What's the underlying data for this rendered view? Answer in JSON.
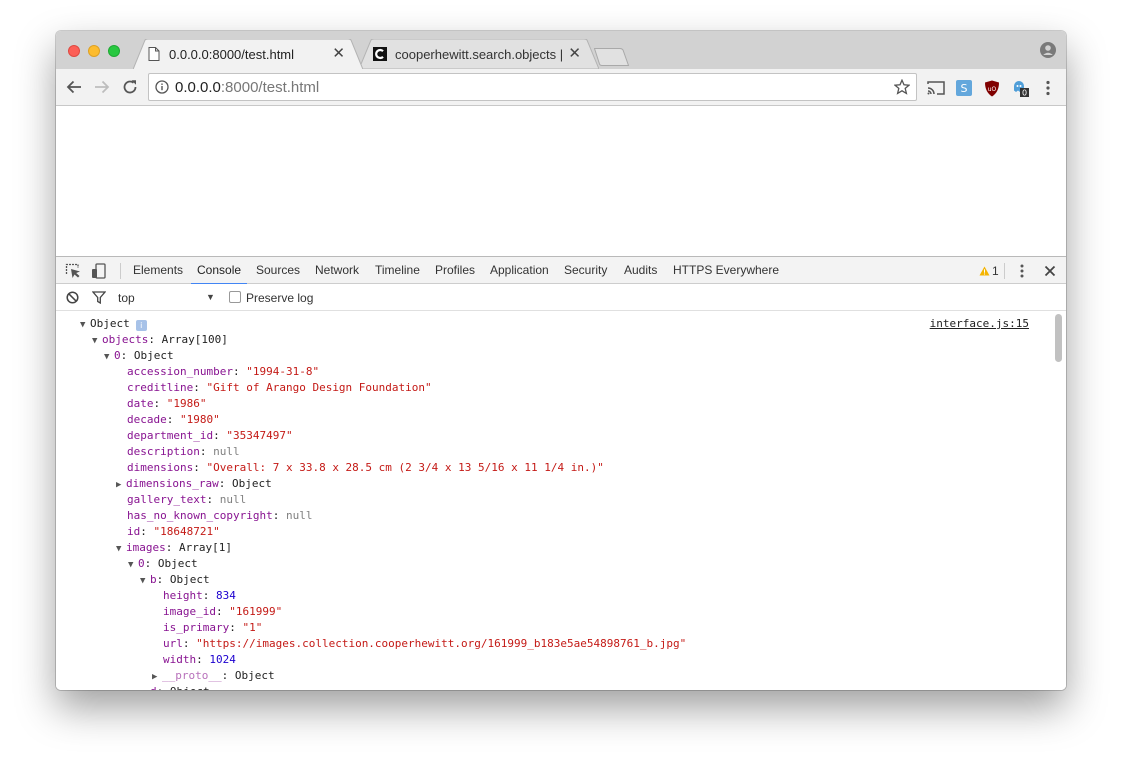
{
  "tabs": [
    {
      "title": "0.0.0.0:8000/test.html",
      "favicon": "page-icon",
      "active": true
    },
    {
      "title": "cooperhewitt.search.objects | C",
      "favicon": "cooper-hewitt-c-icon",
      "active": false
    }
  ],
  "omnibox": {
    "host": "0.0.0.0",
    "rest": ":8000/test.html"
  },
  "devtools": {
    "tabs": [
      "Elements",
      "Console",
      "Sources",
      "Network",
      "Timeline",
      "Profiles",
      "Application",
      "Security",
      "Audits",
      "HTTPS Everywhere"
    ],
    "active_tab": "Console",
    "warning_count": "1",
    "context": "top",
    "preserve_log": "Preserve log"
  },
  "console": {
    "source": "interface.js:15",
    "root": "Object",
    "objects_key": "objects",
    "objects_type": "Array[100]",
    "item0_key": "0",
    "item0_type": "Object",
    "fields": [
      {
        "key": "accession_number",
        "value": "\"1994-31-8\"",
        "kind": "string"
      },
      {
        "key": "creditline",
        "value": "\"Gift of Arango Design Foundation\"",
        "kind": "string"
      },
      {
        "key": "date",
        "value": "\"1986\"",
        "kind": "string"
      },
      {
        "key": "decade",
        "value": "\"1980\"",
        "kind": "string"
      },
      {
        "key": "department_id",
        "value": "\"35347497\"",
        "kind": "string"
      },
      {
        "key": "description",
        "value": "null",
        "kind": "null"
      },
      {
        "key": "dimensions",
        "value": "\"Overall: 7 x 33.8 x 28.5 cm (2 3/4 x 13 5/16 x 11 1/4 in.)\"",
        "kind": "string"
      },
      {
        "key": "dimensions_raw",
        "value": "Object",
        "kind": "object"
      },
      {
        "key": "gallery_text",
        "value": "null",
        "kind": "null"
      },
      {
        "key": "has_no_known_copyright",
        "value": "null",
        "kind": "null"
      },
      {
        "key": "id",
        "value": "\"18648721\"",
        "kind": "string"
      }
    ],
    "images_key": "images",
    "images_type": "Array[1]",
    "img0_key": "0",
    "img0_type": "Object",
    "b_key": "b",
    "b_type": "Object",
    "b_fields": [
      {
        "key": "height",
        "value": "834",
        "kind": "number"
      },
      {
        "key": "image_id",
        "value": "\"161999\"",
        "kind": "string"
      },
      {
        "key": "is_primary",
        "value": "\"1\"",
        "kind": "string"
      },
      {
        "key": "url",
        "value": "\"https://images.collection.cooperhewitt.org/161999_b183e5ae54898761_b.jpg\"",
        "kind": "string"
      },
      {
        "key": "width",
        "value": "1024",
        "kind": "number"
      }
    ],
    "proto_key": "__proto__",
    "proto_type": "Object",
    "d_key": "d",
    "d_type": "Object"
  }
}
